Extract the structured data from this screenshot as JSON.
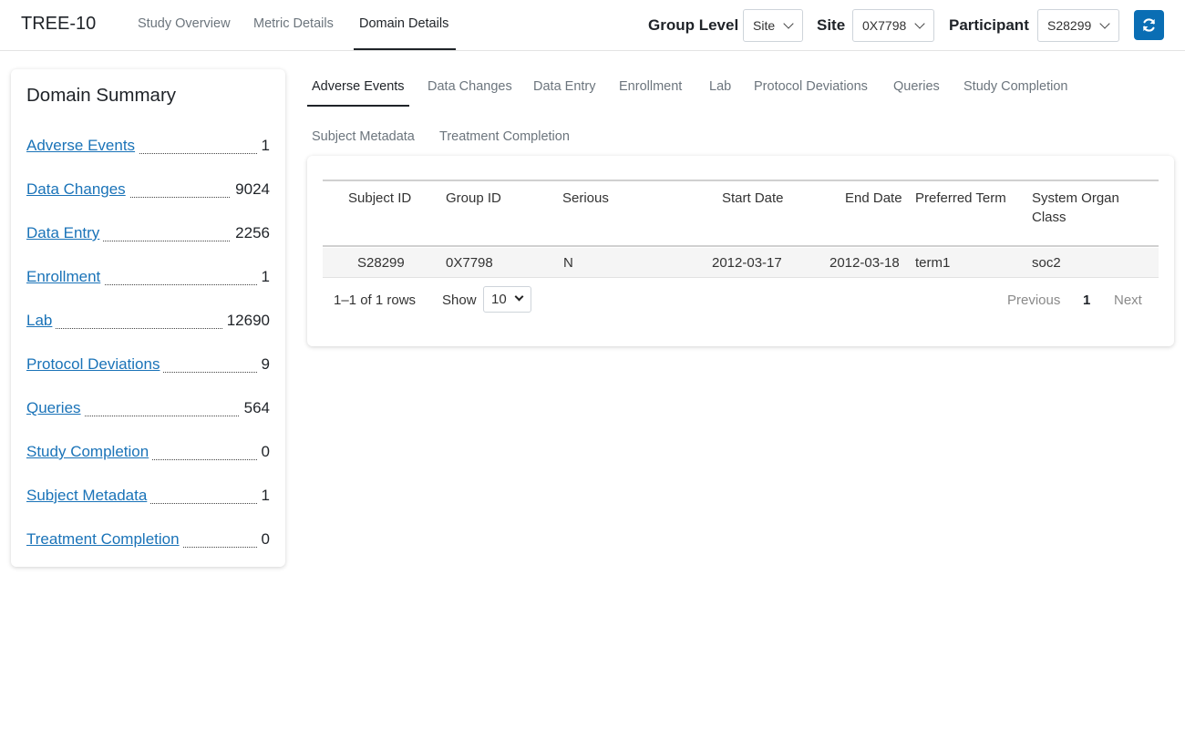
{
  "app": {
    "title": "TREE-10"
  },
  "nav": {
    "tabs": [
      "Study Overview",
      "Metric Details",
      "Domain Details"
    ],
    "active": "Domain Details"
  },
  "filters": {
    "group_level": {
      "label": "Group Level",
      "value": "Site"
    },
    "site": {
      "label": "Site",
      "value": "0X7798"
    },
    "participant": {
      "label": "Participant",
      "value": "S28299"
    }
  },
  "colors": {
    "accent": "#0a6eb4",
    "link": "#1a73b8"
  },
  "summary": {
    "title": "Domain Summary",
    "items": [
      {
        "label": "Adverse Events",
        "count": "1"
      },
      {
        "label": "Data Changes",
        "count": "9024"
      },
      {
        "label": "Data Entry",
        "count": "2256"
      },
      {
        "label": "Enrollment",
        "count": "1"
      },
      {
        "label": "Lab",
        "count": "12690"
      },
      {
        "label": "Protocol Deviations",
        "count": "9"
      },
      {
        "label": "Queries",
        "count": "564"
      },
      {
        "label": "Study Completion",
        "count": "0"
      },
      {
        "label": "Subject Metadata",
        "count": "1"
      },
      {
        "label": "Treatment Completion",
        "count": "0"
      }
    ]
  },
  "domain_tabs": {
    "items": [
      "Adverse Events",
      "Data Changes",
      "Data Entry",
      "Enrollment",
      "Lab",
      "Protocol Deviations",
      "Queries",
      "Study Completion",
      "Subject Metadata",
      "Treatment Completion"
    ],
    "active": "Adverse Events"
  },
  "table": {
    "columns": [
      "Subject ID",
      "Group ID",
      "Serious",
      "Start Date",
      "End Date",
      "Preferred Term",
      "System Organ Class"
    ],
    "rows": [
      [
        "S28299",
        "0X7798",
        "N",
        "2012-03-17",
        "2012-03-18",
        "term1",
        "soc2"
      ]
    ]
  },
  "pagination": {
    "summary": "1–1 of 1 rows",
    "show_label": "Show",
    "page_size": "10",
    "previous": "Previous",
    "current_page": "1",
    "next": "Next"
  }
}
